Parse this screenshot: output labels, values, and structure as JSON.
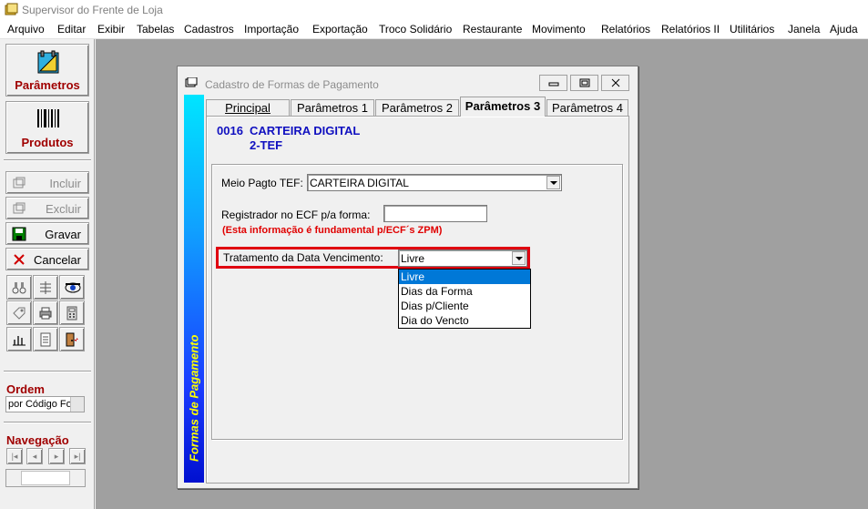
{
  "app": {
    "title": "Supervisor do Frente de Loja"
  },
  "menu": [
    "Arquivo",
    "Editar",
    "Exibir",
    "Tabelas",
    "Cadastros",
    "Importação",
    "Exportação",
    "Troco Solidário",
    "Restaurante",
    "Movimento",
    "Relatórios",
    "Relatórios II",
    "Utilitários",
    "Janela",
    "Ajuda"
  ],
  "left_panel": {
    "parametros_label": "Parâmetros",
    "produtos_label": "Produtos",
    "incluir_label": "Incluir",
    "excluir_label": "Excluir",
    "gravar_label": "Gravar",
    "cancelar_label": "Cancelar",
    "ordem_label": "Ordem",
    "ordem_value": "por Código Fo",
    "navegacao_label": "Navegação"
  },
  "window": {
    "title": "Cadastro de Formas de Pagamento",
    "sidebar_text": "Formas de Pagamento",
    "tabs": [
      "Principal",
      "Parâmetros 1",
      "Parâmetros 2",
      "Parâmetros 3",
      "Parâmetros 4"
    ],
    "active_tab": "Parâmetros 3",
    "record": {
      "code": "0016",
      "name": "CARTEIRA DIGITAL",
      "sub": "2-TEF"
    },
    "fields": {
      "meio_pagto_label": "Meio Pagto TEF:",
      "meio_pagto_value": "CARTEIRA DIGITAL",
      "registrador_label": "Registrador no ECF p/a forma:",
      "registrador_value": "",
      "warning": "(Esta informação é fundamental p/ECF´s ZPM)",
      "tratamento_label": "Tratamento da Data Vencimento:",
      "tratamento_value": "Livre"
    },
    "dropdown_options": [
      "Livre",
      "Dias da Forma",
      "Dias p/Cliente",
      "Dia do Vencto"
    ],
    "selected_option": "Livre"
  },
  "colors": {
    "accent_red": "#a00000",
    "record_blue": "#1010c0",
    "warning_red": "#e00000",
    "selection": "#0078d7"
  }
}
